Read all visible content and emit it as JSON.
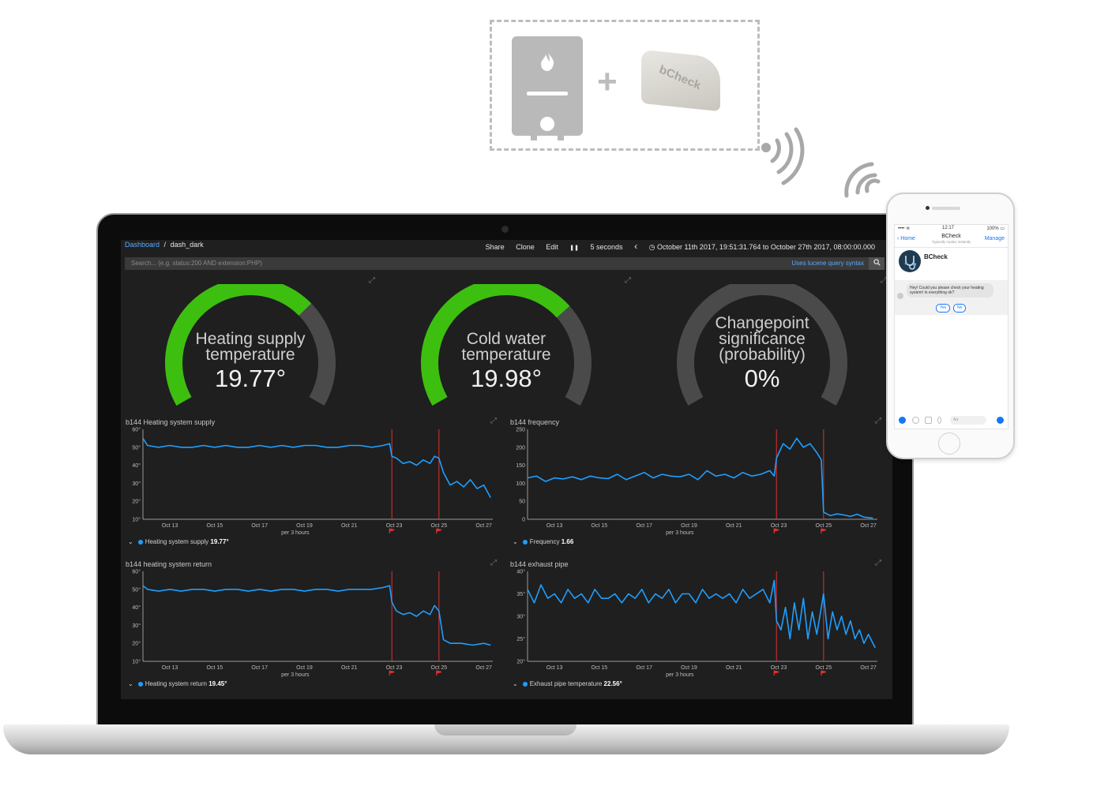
{
  "illustration": {
    "device_label": "bCheck"
  },
  "dashboard": {
    "breadcrumb_root": "Dashboard",
    "breadcrumb_sep": "/",
    "breadcrumb_current": "dash_dark",
    "share": "Share",
    "clone": "Clone",
    "edit": "Edit",
    "pause": "❚❚",
    "refresh_interval": "5 seconds",
    "prev": "‹",
    "time_range": "◷ October 11th 2017, 19:51:31.764 to October 27th 2017, 08:00:00.000",
    "search_placeholder": "Search... (e.g. status:200 AND extension:PHP)",
    "search_hint": "Uses lucene query syntax",
    "search_icon": "search-icon",
    "accent_color": "#1e9fff",
    "gauge_color": "#3dbf0f",
    "gauges": [
      {
        "label_line1": "Heating supply",
        "label_line2": "temperature",
        "label_line3": "",
        "value": "19.77°",
        "fraction": 0.69
      },
      {
        "label_line1": "Cold water",
        "label_line2": "temperature",
        "label_line3": "",
        "value": "19.98°",
        "fraction": 0.7
      },
      {
        "label_line1": "Changepoint",
        "label_line2": "significance",
        "label_line3": "(probability)",
        "value": "0%",
        "fraction": 0.0
      }
    ]
  },
  "chart_data": [
    {
      "type": "line",
      "title": "b144 Heating system supply",
      "xlabel": "per 3 hours",
      "x_ticks": [
        "Oct 13",
        "Oct 15",
        "Oct 17",
        "Oct 19",
        "Oct 21",
        "Oct 23",
        "Oct 25",
        "Oct 27"
      ],
      "y_ticks": [
        "10°",
        "20°",
        "30°",
        "40°",
        "50°",
        "60°"
      ],
      "ylim": [
        10,
        60
      ],
      "xlim": [
        11.8,
        27.4
      ],
      "changepoints": [
        22.9,
        25.0
      ],
      "legend_name": "Heating system supply",
      "legend_value": "19.77°",
      "series": [
        {
          "x": [
            11.8,
            12.0,
            12.5,
            13.0,
            13.5,
            14.0,
            14.5,
            15.0,
            15.5,
            16.0,
            16.5,
            17.0,
            17.5,
            18.0,
            18.5,
            19.0,
            19.5,
            20.0,
            20.5,
            21.0,
            21.5,
            22.0,
            22.5,
            22.8,
            22.9,
            23.1,
            23.4,
            23.7,
            24.0,
            24.3,
            24.6,
            24.8,
            25.0,
            25.2,
            25.5,
            25.8,
            26.1,
            26.4,
            26.7,
            27.0,
            27.3
          ],
          "y": [
            55,
            51,
            50,
            51,
            50,
            50,
            51,
            50,
            51,
            50,
            50,
            51,
            50,
            51,
            50,
            51,
            51,
            50,
            50,
            51,
            51,
            50,
            51,
            52,
            45,
            44,
            41,
            42,
            40,
            43,
            41,
            45,
            44,
            36,
            29,
            31,
            28,
            32,
            27,
            29,
            22
          ]
        }
      ]
    },
    {
      "type": "line",
      "title": "b144 frequency",
      "xlabel": "per 3 hours",
      "x_ticks": [
        "Oct 13",
        "Oct 15",
        "Oct 17",
        "Oct 19",
        "Oct 21",
        "Oct 23",
        "Oct 25",
        "Oct 27"
      ],
      "y_ticks": [
        "0",
        "50",
        "100",
        "150",
        "200",
        "250"
      ],
      "ylim": [
        0,
        250
      ],
      "xlim": [
        11.8,
        27.4
      ],
      "changepoints": [
        22.9,
        25.0
      ],
      "legend_name": "Frequency",
      "legend_value": "1.66",
      "series": [
        {
          "x": [
            11.8,
            12.2,
            12.6,
            13.0,
            13.4,
            13.8,
            14.2,
            14.6,
            15.0,
            15.4,
            15.8,
            16.2,
            16.6,
            17.0,
            17.4,
            17.8,
            18.2,
            18.6,
            19.0,
            19.4,
            19.8,
            20.2,
            20.6,
            21.0,
            21.4,
            21.8,
            22.2,
            22.6,
            22.8,
            22.9,
            23.2,
            23.5,
            23.8,
            24.1,
            24.4,
            24.7,
            24.9,
            25.0,
            25.3,
            25.6,
            25.9,
            26.2,
            26.5,
            26.8,
            27.2
          ],
          "y": [
            115,
            120,
            105,
            115,
            112,
            118,
            110,
            120,
            115,
            113,
            125,
            110,
            120,
            130,
            115,
            125,
            120,
            118,
            125,
            110,
            135,
            120,
            125,
            115,
            130,
            120,
            125,
            135,
            120,
            170,
            210,
            195,
            225,
            200,
            210,
            185,
            165,
            20,
            10,
            15,
            12,
            8,
            14,
            6,
            3
          ]
        }
      ]
    },
    {
      "type": "line",
      "title": "b144 heating system return",
      "xlabel": "per 3 hours",
      "x_ticks": [
        "Oct 13",
        "Oct 15",
        "Oct 17",
        "Oct 19",
        "Oct 21",
        "Oct 23",
        "Oct 25",
        "Oct 27"
      ],
      "y_ticks": [
        "10°",
        "20°",
        "30°",
        "40°",
        "50°",
        "60°"
      ],
      "ylim": [
        10,
        60
      ],
      "xlim": [
        11.8,
        27.4
      ],
      "changepoints": [
        22.9,
        25.0
      ],
      "legend_name": "Heating system return",
      "legend_value": "19.45°",
      "series": [
        {
          "x": [
            11.8,
            12.0,
            12.5,
            13.0,
            13.5,
            14.0,
            14.5,
            15.0,
            15.5,
            16.0,
            16.5,
            17.0,
            17.5,
            18.0,
            18.5,
            19.0,
            19.5,
            20.0,
            20.5,
            21.0,
            21.5,
            22.0,
            22.5,
            22.8,
            22.9,
            23.1,
            23.4,
            23.7,
            24.0,
            24.3,
            24.6,
            24.8,
            25.0,
            25.2,
            25.5,
            26.0,
            26.5,
            27.0,
            27.3
          ],
          "y": [
            52,
            50,
            49,
            50,
            49,
            50,
            50,
            49,
            50,
            50,
            49,
            50,
            49,
            50,
            50,
            49,
            50,
            50,
            49,
            50,
            50,
            50,
            51,
            52,
            43,
            38,
            36,
            37,
            35,
            38,
            36,
            41,
            38,
            22,
            20,
            20,
            19,
            20,
            19
          ]
        }
      ]
    },
    {
      "type": "line",
      "title": "b144 exhaust pipe",
      "xlabel": "per 3 hours",
      "x_ticks": [
        "Oct 13",
        "Oct 15",
        "Oct 17",
        "Oct 19",
        "Oct 21",
        "Oct 23",
        "Oct 25",
        "Oct 27"
      ],
      "y_ticks": [
        "20°",
        "25°",
        "30°",
        "35°",
        "40°"
      ],
      "ylim": [
        20,
        40
      ],
      "xlim": [
        11.8,
        27.4
      ],
      "changepoints": [
        22.9,
        25.0
      ],
      "legend_name": "Exhaust pipe temperature",
      "legend_value": "22.56°",
      "series": [
        {
          "x": [
            11.8,
            12.1,
            12.4,
            12.7,
            13.0,
            13.3,
            13.6,
            13.9,
            14.2,
            14.5,
            14.8,
            15.1,
            15.4,
            15.7,
            16.0,
            16.3,
            16.6,
            16.9,
            17.2,
            17.5,
            17.8,
            18.1,
            18.4,
            18.7,
            19.0,
            19.3,
            19.6,
            19.9,
            20.2,
            20.5,
            20.8,
            21.1,
            21.4,
            21.7,
            22.0,
            22.3,
            22.6,
            22.8,
            22.9,
            23.1,
            23.3,
            23.5,
            23.7,
            23.9,
            24.1,
            24.3,
            24.5,
            24.7,
            24.9,
            25.0,
            25.2,
            25.4,
            25.6,
            25.8,
            26.0,
            26.2,
            26.4,
            26.6,
            26.8,
            27.0,
            27.3
          ],
          "y": [
            36,
            33,
            37,
            34,
            35,
            33,
            36,
            34,
            35,
            33,
            36,
            34,
            34,
            35,
            33,
            35,
            34,
            36,
            33,
            35,
            34,
            36,
            33,
            35,
            35,
            33,
            36,
            34,
            35,
            34,
            35,
            33,
            36,
            34,
            35,
            36,
            33,
            38,
            29,
            27,
            32,
            25,
            33,
            27,
            34,
            25,
            31,
            26,
            32,
            35,
            25,
            31,
            27,
            30,
            26,
            29,
            25,
            27,
            24,
            26,
            23
          ]
        }
      ]
    }
  ],
  "phone": {
    "time": "12:17",
    "signal": "•••• ≋",
    "battery": "100% ▭",
    "back": "‹ Home",
    "title": "BCheck",
    "subtitle": "Typically replies instantly",
    "manage": "Manage",
    "bot_name": "BCheck",
    "message": "Hey! Could you please check your heating system! Is everything ok?",
    "reply_yes": "Yes",
    "reply_no": "No",
    "input_placeholder": "Aa"
  }
}
